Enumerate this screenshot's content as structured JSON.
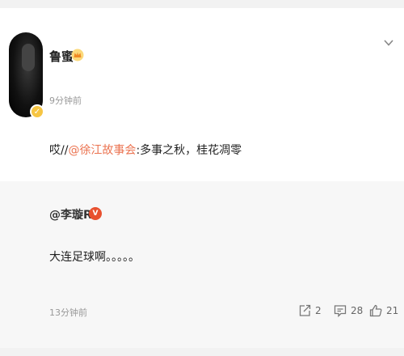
{
  "post": {
    "username": "鲁蜜",
    "time": "9分钟前",
    "text_prefix": "哎//",
    "mention": "@徐江故事会",
    "text_suffix": ":多事之秋，桂花凋零"
  },
  "repost": {
    "username": "@李璇R9",
    "badge": "V",
    "text": "大连足球啊。。。。。",
    "time": "13分钟前",
    "actions": {
      "share_count": "2",
      "comment_count": "28",
      "like_count": "21"
    }
  },
  "colors": {
    "mention": "#eb7350",
    "verified_badge": "#f6c543",
    "repost_badge": "#e8502f",
    "repost_bg": "#f7f7f7"
  },
  "icons": {
    "menu": "chevron-down-icon",
    "crown": "crown-icon",
    "share": "share-icon",
    "comment": "comment-icon",
    "like": "thumbs-up-icon"
  }
}
